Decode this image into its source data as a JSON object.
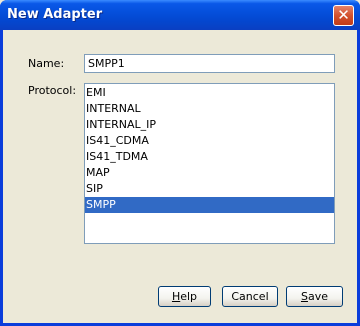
{
  "dialog": {
    "title": "New Adapter",
    "close_label": "✕"
  },
  "form": {
    "name_label": "Name:",
    "name_value": "SMPP1",
    "protocol_label": "Protocol:"
  },
  "protocols": {
    "items": [
      "EMI",
      "INTERNAL",
      "INTERNAL_IP",
      "IS41_CDMA",
      "IS41_TDMA",
      "MAP",
      "SIP",
      "SMPP"
    ],
    "selected": "SMPP"
  },
  "buttons": {
    "help": "Help",
    "cancel": "Cancel",
    "save": "Save"
  },
  "colors": {
    "titlebar": "#0550dc",
    "selection": "#316ac5",
    "dialog_bg": "#ece9d8"
  }
}
